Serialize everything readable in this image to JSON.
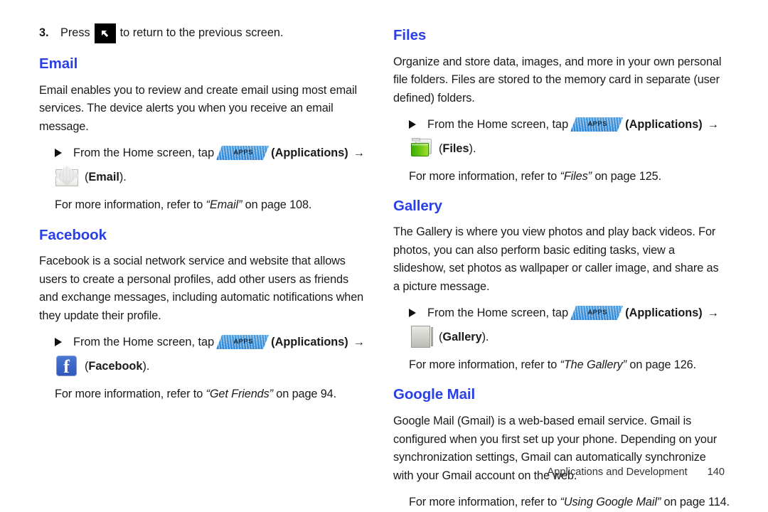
{
  "document": {
    "footer": {
      "chapter": "Applications and Development",
      "page_number": "140"
    }
  },
  "left_column": {
    "step": {
      "number": "3.",
      "text_before_icon": "Press",
      "icon": "back-key-icon",
      "text_after_icon": "to return to the previous screen."
    },
    "sections": [
      {
        "heading": "Email",
        "body": "Email enables you to review and create email using most email services. The device alerts you when you receive an email message.",
        "bullet": {
          "lead": "From the Home screen, tap",
          "apps_icon_label": "APPS",
          "apps_name": "(Applications)",
          "arrow": "→",
          "app_icon": "email-icon",
          "app_label_open": "(",
          "app_label": "Email",
          "app_label_close": ")."
        },
        "reference": {
          "prefix": "For more information, refer to",
          "title": "“Email”",
          "suffix": "on page 108."
        }
      },
      {
        "heading": "Facebook",
        "body": "Facebook is a social network service and website that allows users to create a personal profiles, add other users as friends and exchange messages, including automatic notifications when they update their profile.",
        "bullet": {
          "lead": "From the Home screen, tap",
          "apps_icon_label": "APPS",
          "apps_name": "(Applications)",
          "arrow": "→",
          "app_icon": "facebook-icon",
          "app_label_open": "(",
          "app_label": "Facebook",
          "app_label_close": ")."
        },
        "reference": {
          "prefix": "For more information, refer to",
          "title": "“Get Friends”",
          "suffix": "on page 94."
        }
      }
    ]
  },
  "right_column": {
    "sections": [
      {
        "heading": "Files",
        "body": "Organize and store data, images, and more in your own personal file folders. Files are stored to the memory card in separate (user defined) folders.",
        "bullet": {
          "lead": "From the Home screen, tap",
          "apps_icon_label": "APPS",
          "apps_name": "(Applications)",
          "arrow": "→",
          "app_icon": "files-folder-icon",
          "app_label_open": "(",
          "app_label": "Files",
          "app_label_close": ")."
        },
        "reference": {
          "prefix": "For more information, refer to",
          "title": "“Files”",
          "suffix": "on page 125."
        }
      },
      {
        "heading": "Gallery",
        "body": "The Gallery is where you view photos and play back videos. For photos, you can also perform basic editing tasks, view a slideshow, set photos as wallpaper or caller image, and share as a picture message.",
        "bullet": {
          "lead": "From the Home screen, tap",
          "apps_icon_label": "APPS",
          "apps_name": "(Applications)",
          "arrow": "→",
          "app_icon": "gallery-icon",
          "app_label_open": "(",
          "app_label": "Gallery",
          "app_label_close": ")."
        },
        "reference": {
          "prefix": "For more information, refer to",
          "title": "“The Gallery”",
          "suffix": "on page 126."
        }
      },
      {
        "heading": "Google Mail",
        "body": "Google Mail (Gmail) is a web-based email service. Gmail is configured when you first set up your phone. Depending on your synchronization settings, Gmail can automatically synchronize with your Gmail account on the web.",
        "reference": {
          "prefix": "For more information, refer to",
          "title": "“Using Google Mail”",
          "suffix": "on page 114."
        }
      }
    ]
  },
  "colors": {
    "heading_blue": "#2a3fe6",
    "apps_blue": "#3f93db",
    "facebook_blue": "#3b5ec4",
    "files_green": "#63c40e",
    "gallery_orange": "#ffb300",
    "text_black": "#1a1a1a"
  }
}
